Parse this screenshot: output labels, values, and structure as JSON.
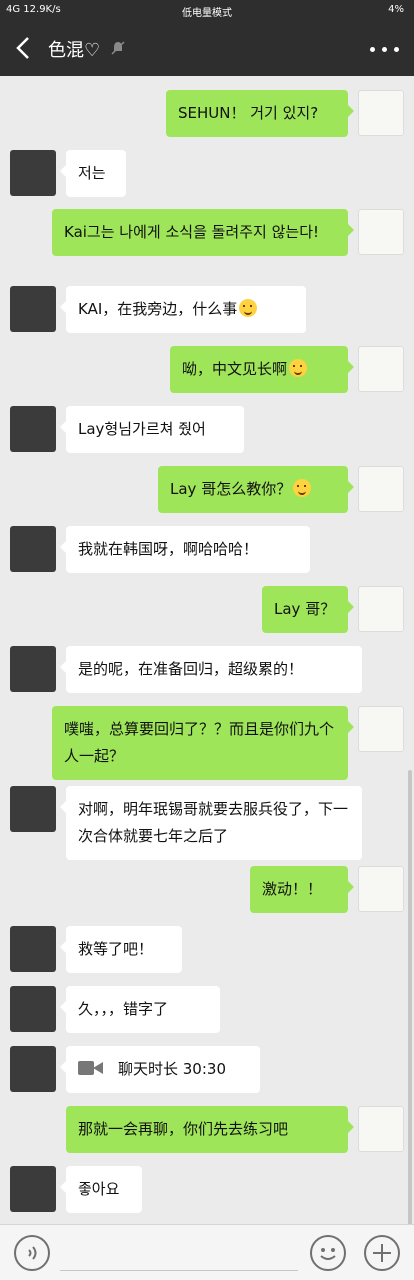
{
  "status_bar": {
    "left": "4G 12.9K/s",
    "center": "低电量模式",
    "right": "4%"
  },
  "nav": {
    "title": "色混♡"
  },
  "messages": [
    {
      "side": "right",
      "text": "SEHUN！ 거기 있지?"
    },
    {
      "side": "left",
      "text": "저는"
    },
    {
      "side": "right",
      "text": "Kai그는 나에게 소식을 돌려주지 않는다!"
    },
    {
      "side": "left",
      "text": "KAI，在我旁边，什么事",
      "emoji": "smile-emoji"
    },
    {
      "side": "right",
      "text": "呦，中文见长啊",
      "emoji": "smirk-emoji"
    },
    {
      "side": "left",
      "text": "Lay형님가르쳐 줬어"
    },
    {
      "side": "right",
      "text": "Lay 哥怎么教你？",
      "emoji": "flushed-emoji"
    },
    {
      "side": "left",
      "text": "我就在韩国呀，啊哈哈哈！"
    },
    {
      "side": "right",
      "text": "Lay 哥？"
    },
    {
      "side": "left",
      "text": "是的呢，在准备回归，超级累的！"
    },
    {
      "side": "right",
      "text": "噗嗤，总算要回归了？？而且是你们九个人一起？"
    },
    {
      "side": "left",
      "text": "对啊，明年珉锡哥就要去服兵役了，下一次合体就要七年之后了"
    },
    {
      "side": "right",
      "text": "激动！！"
    },
    {
      "side": "left",
      "text": "救等了吧！"
    },
    {
      "side": "left",
      "text": "久，，，错字了"
    },
    {
      "side": "left",
      "text": "聊天时长 30:30",
      "icon": "video-call-icon"
    },
    {
      "side": "right",
      "text": "那就一会再聊，你们先去练习吧"
    },
    {
      "side": "left",
      "text": "좋아요"
    }
  ],
  "colors": {
    "bubble_right": "#9fe559",
    "bubble_left": "#ffffff",
    "header": "#2e2e2e"
  }
}
